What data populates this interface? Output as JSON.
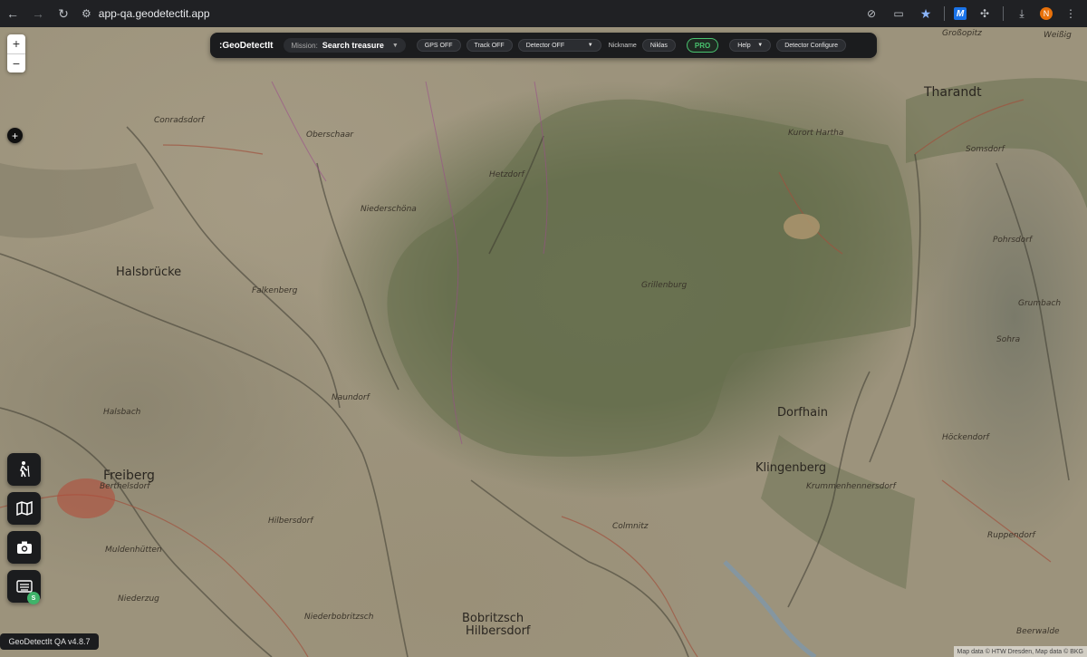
{
  "browser": {
    "url": "app-qa.geodetectit.app",
    "profile_initial": "N",
    "extension_letter": "M"
  },
  "toolbar": {
    "brand": ":GeoDetectIt",
    "mission_label": "Mission:",
    "mission_value": "Search treasure",
    "gps": "GPS OFF",
    "track": "Track OFF",
    "detector": "Detector OFF",
    "nickname_label": "Nickname",
    "nickname_value": "Niklas",
    "pro": "PRO",
    "help": "Help",
    "detector_configure": "Detector Configure"
  },
  "map": {
    "zoom_in": "+",
    "zoom_out": "−",
    "add_pin": "+",
    "places": [
      {
        "name": "Tharandt",
        "cls": "city"
      },
      {
        "name": "Halsbrücke",
        "cls": "major"
      },
      {
        "name": "Freiberg",
        "cls": "city"
      },
      {
        "name": "Dorfhain",
        "cls": "major"
      },
      {
        "name": "Klingenberg",
        "cls": "major"
      },
      {
        "name": "Bobritzsch",
        "cls": "major"
      },
      {
        "name": "Hilbersdorf",
        "cls": "major"
      },
      {
        "name": "Niederschöna",
        "cls": "minor"
      },
      {
        "name": "Naundorf",
        "cls": "minor"
      },
      {
        "name": "Hilbersdorf",
        "cls": "minor"
      },
      {
        "name": "Grillenburg",
        "cls": "minor"
      },
      {
        "name": "Colmnitz",
        "cls": "minor"
      },
      {
        "name": "Niederbobritzsch",
        "cls": "minor"
      },
      {
        "name": "Muldenhütten",
        "cls": "minor"
      },
      {
        "name": "Hetzdorf",
        "cls": "minor"
      },
      {
        "name": "Sohra",
        "cls": "minor"
      },
      {
        "name": "Pohrsdorf",
        "cls": "minor"
      },
      {
        "name": "Grumbach",
        "cls": "minor"
      },
      {
        "name": "Ruppendorf",
        "cls": "minor"
      },
      {
        "name": "Höckendorf",
        "cls": "minor"
      },
      {
        "name": "Kurort Hartha",
        "cls": "minor"
      },
      {
        "name": "Weißig",
        "cls": "minor"
      },
      {
        "name": "Großopitz",
        "cls": "minor"
      },
      {
        "name": "Somsdorf",
        "cls": "minor"
      },
      {
        "name": "Conradsdorf",
        "cls": "minor"
      },
      {
        "name": "Falkenberg",
        "cls": "minor"
      },
      {
        "name": "Halsbach",
        "cls": "minor"
      },
      {
        "name": "Berthelsdorf",
        "cls": "minor"
      },
      {
        "name": "Niederzug",
        "cls": "minor"
      },
      {
        "name": "Krummenhennersdorf",
        "cls": "minor"
      },
      {
        "name": "Oberschaar",
        "cls": "minor"
      },
      {
        "name": "Beerwalde",
        "cls": "minor"
      }
    ]
  },
  "actions": {
    "badge": "S"
  },
  "version": "GeoDetectIt QA v4.8.7",
  "attribution": "Map data © HTW Dresden, Map data © BKG"
}
